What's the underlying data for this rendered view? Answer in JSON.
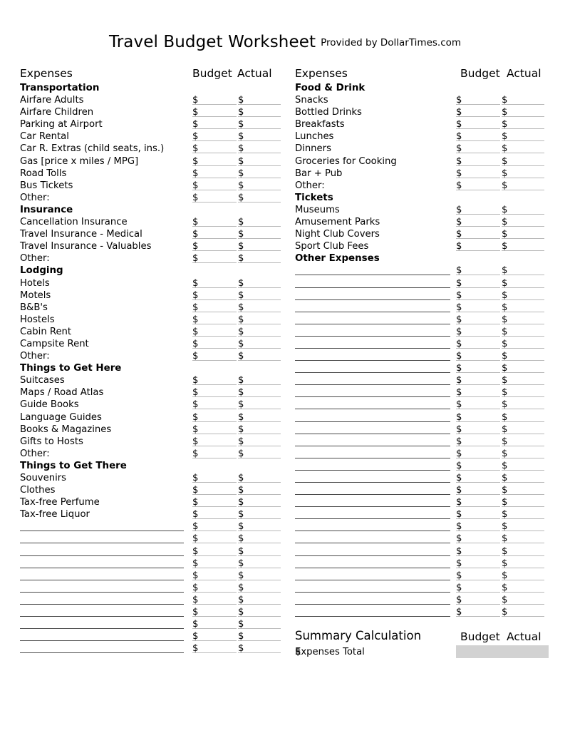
{
  "document": {
    "title": "Travel Budget Worksheet",
    "credit": "Provided by DollarTimes.com"
  },
  "columns": {
    "left": {
      "header": {
        "expenses": "Expenses",
        "budget": "Budget",
        "actual": "Actual"
      },
      "rows": [
        {
          "type": "section",
          "label": "Transportation",
          "money": false
        },
        {
          "type": "item",
          "label": "Airfare Adults",
          "money": true
        },
        {
          "type": "item",
          "label": "Airfare Children",
          "money": true
        },
        {
          "type": "item",
          "label": "Parking at Airport",
          "money": true
        },
        {
          "type": "item",
          "label": "Car Rental",
          "money": true
        },
        {
          "type": "item",
          "label": "Car R. Extras (child seats, ins.)",
          "money": true
        },
        {
          "type": "item",
          "label": "Gas [price x miles / MPG]",
          "money": true
        },
        {
          "type": "item",
          "label": "Road Tolls",
          "money": true
        },
        {
          "type": "item",
          "label": "Bus Tickets",
          "money": true
        },
        {
          "type": "item",
          "label": "Other:",
          "money": true
        },
        {
          "type": "section",
          "label": "Insurance",
          "money": false
        },
        {
          "type": "item",
          "label": "Cancellation Insurance",
          "money": true
        },
        {
          "type": "item",
          "label": "Travel Insurance - Medical",
          "money": true
        },
        {
          "type": "item",
          "label": "Travel Insurance - Valuables",
          "money": true
        },
        {
          "type": "item",
          "label": "Other:",
          "money": true
        },
        {
          "type": "section",
          "label": "Lodging",
          "money": false
        },
        {
          "type": "item",
          "label": "Hotels",
          "money": true
        },
        {
          "type": "item",
          "label": "Motels",
          "money": true
        },
        {
          "type": "item",
          "label": "B&B's",
          "money": true
        },
        {
          "type": "item",
          "label": "Hostels",
          "money": true
        },
        {
          "type": "item",
          "label": "Cabin Rent",
          "money": true
        },
        {
          "type": "item",
          "label": "Campsite Rent",
          "money": true
        },
        {
          "type": "item",
          "label": "Other:",
          "money": true
        },
        {
          "type": "section",
          "label": "Things to Get Here",
          "money": false
        },
        {
          "type": "item",
          "label": "Suitcases",
          "money": true
        },
        {
          "type": "item",
          "label": "Maps / Road Atlas",
          "money": true
        },
        {
          "type": "item",
          "label": "Guide Books",
          "money": true
        },
        {
          "type": "item",
          "label": "Language Guides",
          "money": true
        },
        {
          "type": "item",
          "label": "Books & Magazines",
          "money": true
        },
        {
          "type": "item",
          "label": "Gifts to Hosts",
          "money": true
        },
        {
          "type": "item",
          "label": "Other:",
          "money": true
        },
        {
          "type": "section",
          "label": "Things to Get There",
          "money": false
        },
        {
          "type": "item",
          "label": "Souvenirs",
          "money": true
        },
        {
          "type": "item",
          "label": "Clothes",
          "money": true
        },
        {
          "type": "item",
          "label": "Tax-free Perfume",
          "money": true
        },
        {
          "type": "item",
          "label": "Tax-free Liquor",
          "money": true
        },
        {
          "type": "blank",
          "label": "",
          "money": true
        },
        {
          "type": "blank",
          "label": "",
          "money": true
        },
        {
          "type": "blank",
          "label": "",
          "money": true
        },
        {
          "type": "blank",
          "label": "",
          "money": true
        },
        {
          "type": "blank",
          "label": "",
          "money": true
        },
        {
          "type": "blank",
          "label": "",
          "money": true
        },
        {
          "type": "blank",
          "label": "",
          "money": true
        },
        {
          "type": "blank",
          "label": "",
          "money": true
        },
        {
          "type": "blank",
          "label": "",
          "money": true
        },
        {
          "type": "blank",
          "label": "",
          "money": true
        },
        {
          "type": "blank",
          "label": "",
          "money": true
        }
      ]
    },
    "right": {
      "header": {
        "expenses": "Expenses",
        "budget": "Budget",
        "actual": "Actual"
      },
      "rows": [
        {
          "type": "section",
          "label": "Food & Drink",
          "money": false
        },
        {
          "type": "item",
          "label": "Snacks",
          "money": true
        },
        {
          "type": "item",
          "label": "Bottled Drinks",
          "money": true
        },
        {
          "type": "item",
          "label": "Breakfasts",
          "money": true
        },
        {
          "type": "item",
          "label": "Lunches",
          "money": true
        },
        {
          "type": "item",
          "label": "Dinners",
          "money": true
        },
        {
          "type": "item",
          "label": "Groceries for Cooking",
          "money": true
        },
        {
          "type": "item",
          "label": "Bar + Pub",
          "money": true
        },
        {
          "type": "item",
          "label": "Other:",
          "money": true
        },
        {
          "type": "section",
          "label": "Tickets",
          "money": false
        },
        {
          "type": "item",
          "label": "Museums",
          "money": true
        },
        {
          "type": "item",
          "label": "Amusement Parks",
          "money": true
        },
        {
          "type": "item",
          "label": "Night Club Covers",
          "money": true
        },
        {
          "type": "item",
          "label": "Sport Club Fees",
          "money": true
        },
        {
          "type": "section",
          "label": "Other Expenses",
          "money": false
        },
        {
          "type": "blank",
          "label": "",
          "money": true
        },
        {
          "type": "blank",
          "label": "",
          "money": true
        },
        {
          "type": "blank",
          "label": "",
          "money": true
        },
        {
          "type": "blank",
          "label": "",
          "money": true
        },
        {
          "type": "blank",
          "label": "",
          "money": true
        },
        {
          "type": "blank",
          "label": "",
          "money": true
        },
        {
          "type": "blank",
          "label": "",
          "money": true
        },
        {
          "type": "blank",
          "label": "",
          "money": true
        },
        {
          "type": "blank",
          "label": "",
          "money": true
        },
        {
          "type": "blank",
          "label": "",
          "money": true
        },
        {
          "type": "blank",
          "label": "",
          "money": true
        },
        {
          "type": "blank",
          "label": "",
          "money": true
        },
        {
          "type": "blank",
          "label": "",
          "money": true
        },
        {
          "type": "blank",
          "label": "",
          "money": true
        },
        {
          "type": "blank",
          "label": "",
          "money": true
        },
        {
          "type": "blank",
          "label": "",
          "money": true
        },
        {
          "type": "blank",
          "label": "",
          "money": true
        },
        {
          "type": "blank",
          "label": "",
          "money": true
        },
        {
          "type": "blank",
          "label": "",
          "money": true
        },
        {
          "type": "blank",
          "label": "",
          "money": true
        },
        {
          "type": "blank",
          "label": "",
          "money": true
        },
        {
          "type": "blank",
          "label": "",
          "money": true
        },
        {
          "type": "blank",
          "label": "",
          "money": true
        },
        {
          "type": "blank",
          "label": "",
          "money": true
        },
        {
          "type": "blank",
          "label": "",
          "money": true
        },
        {
          "type": "blank",
          "label": "",
          "money": true
        },
        {
          "type": "blank",
          "label": "",
          "money": true
        },
        {
          "type": "blank",
          "label": "",
          "money": true
        },
        {
          "type": "blank",
          "label": "",
          "money": true
        }
      ]
    }
  },
  "summary": {
    "title": "Summary Calculation",
    "budget_header": "Budget",
    "actual_header": "Actual",
    "total_label": "Expenses Total",
    "shade_color": "#d2d2d2"
  },
  "currency_symbol": "$"
}
